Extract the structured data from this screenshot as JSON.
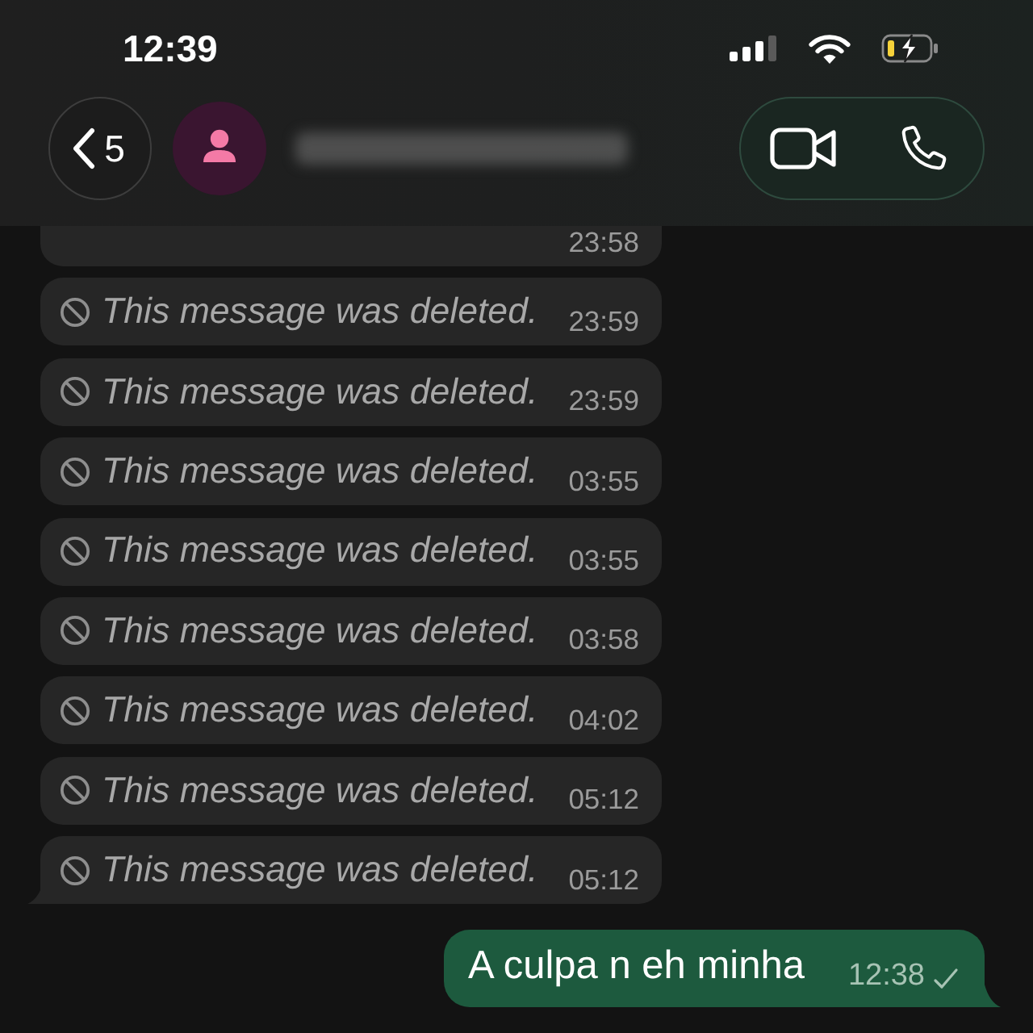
{
  "status_bar": {
    "time": "12:39",
    "battery_charging": true,
    "low_power_mode": true
  },
  "header": {
    "back_count": "5",
    "name_redacted": true
  },
  "messages": [
    {
      "kind": "deleted",
      "outgoing": false,
      "partial": true,
      "tail": false,
      "time": "23:58"
    },
    {
      "kind": "deleted",
      "outgoing": false,
      "partial": false,
      "tail": false,
      "text": "This message was deleted.",
      "time": "23:59"
    },
    {
      "kind": "deleted",
      "outgoing": false,
      "partial": false,
      "tail": false,
      "text": "This message was deleted.",
      "time": "23:59"
    },
    {
      "kind": "deleted",
      "outgoing": false,
      "partial": false,
      "tail": false,
      "text": "This message was deleted.",
      "time": "03:55"
    },
    {
      "kind": "deleted",
      "outgoing": false,
      "partial": false,
      "tail": false,
      "text": "This message was deleted.",
      "time": "03:55"
    },
    {
      "kind": "deleted",
      "outgoing": false,
      "partial": false,
      "tail": false,
      "text": "This message was deleted.",
      "time": "03:58"
    },
    {
      "kind": "deleted",
      "outgoing": false,
      "partial": false,
      "tail": false,
      "text": "This message was deleted.",
      "time": "04:02"
    },
    {
      "kind": "deleted",
      "outgoing": false,
      "partial": false,
      "tail": false,
      "text": "This message was deleted.",
      "time": "05:12"
    },
    {
      "kind": "deleted",
      "outgoing": false,
      "partial": false,
      "tail": true,
      "text": "This message was deleted.",
      "time": "05:12"
    },
    {
      "kind": "text",
      "outgoing": true,
      "partial": false,
      "tail": true,
      "text": "A culpa n eh minha",
      "time": "12:38",
      "delivered": false
    }
  ]
}
